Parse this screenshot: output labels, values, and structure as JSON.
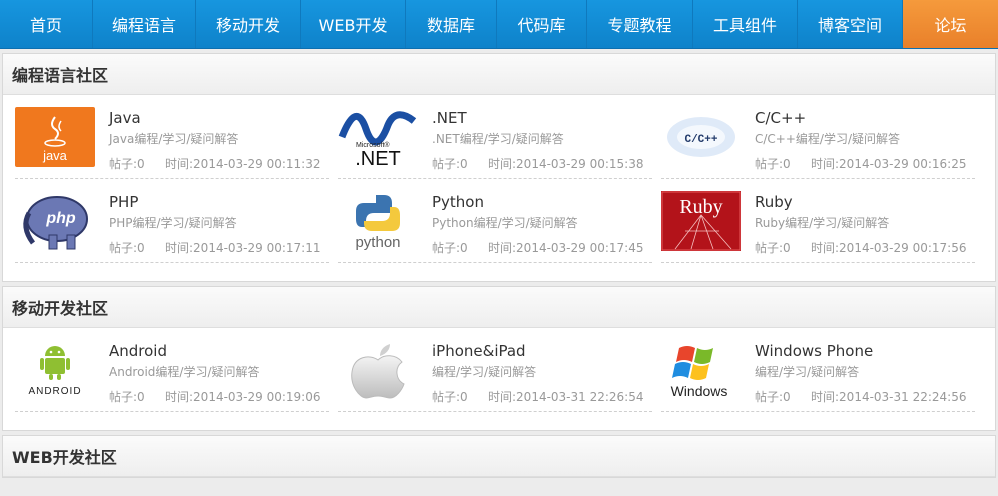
{
  "nav": [
    {
      "label": "首页",
      "w": 93
    },
    {
      "label": "编程语言",
      "w": 103
    },
    {
      "label": "移动开发",
      "w": 105
    },
    {
      "label": "WEB开发",
      "w": 105
    },
    {
      "label": "数据库",
      "w": 91
    },
    {
      "label": "代码库",
      "w": 90
    },
    {
      "label": "专题教程",
      "w": 106
    },
    {
      "label": "工具组件",
      "w": 105
    },
    {
      "label": "博客空间",
      "w": 105
    },
    {
      "label": "论坛",
      "w": 95,
      "active": true
    }
  ],
  "sections": [
    {
      "title": "编程语言社区",
      "forums": [
        {
          "name": "Java",
          "desc": "Java编程/学习/疑问解答",
          "posts": "帖子:0",
          "time": "时间:2014-03-29 00:11:32",
          "logo": "java-logo-icon"
        },
        {
          "name": ".NET",
          "desc": ".NET编程/学习/疑问解答",
          "posts": "帖子:0",
          "time": "时间:2014-03-29 00:15:38",
          "logo": "dotnet-logo-icon"
        },
        {
          "name": "C/C++",
          "desc": "C/C++编程/学习/疑问解答",
          "posts": "帖子:0",
          "time": "时间:2014-03-29 00:16:25",
          "logo": "cpp-logo-icon"
        },
        {
          "name": "PHP",
          "desc": "PHP编程/学习/疑问解答",
          "posts": "帖子:0",
          "time": "时间:2014-03-29 00:17:11",
          "logo": "php-logo-icon"
        },
        {
          "name": "Python",
          "desc": "Python编程/学习/疑问解答",
          "posts": "帖子:0",
          "time": "时间:2014-03-29 00:17:45",
          "logo": "python-logo-icon"
        },
        {
          "name": "Ruby",
          "desc": "Ruby编程/学习/疑问解答",
          "posts": "帖子:0",
          "time": "时间:2014-03-29 00:17:56",
          "logo": "ruby-logo-icon"
        }
      ]
    },
    {
      "title": "移动开发社区",
      "forums": [
        {
          "name": "Android",
          "desc": "Android编程/学习/疑问解答",
          "posts": "帖子:0",
          "time": "时间:2014-03-29 00:19:06",
          "logo": "android-logo-icon"
        },
        {
          "name": "iPhone&iPad",
          "desc": "编程/学习/疑问解答",
          "posts": "帖子:0",
          "time": "时间:2014-03-31 22:26:54",
          "logo": "apple-logo-icon"
        },
        {
          "name": "Windows Phone",
          "desc": "编程/学习/疑问解答",
          "posts": "帖子:0",
          "time": "时间:2014-03-31 22:24:56",
          "logo": "windows-logo-icon"
        }
      ]
    },
    {
      "title": "WEB开发社区",
      "forums": []
    }
  ],
  "logos": {
    "java": "java",
    "dotnet_ms": "Microsoft®",
    "dotnet": ".NET",
    "cpp": "C/C++",
    "php": "php",
    "python": "python",
    "ruby": "Ruby",
    "android": "ANDROID",
    "windows": "Windows"
  },
  "colors": {
    "nav": "#138bd5",
    "active": "#ef8c33",
    "java": "#f0781e",
    "ruby": "#b3131a",
    "android": "#8fbf32"
  }
}
